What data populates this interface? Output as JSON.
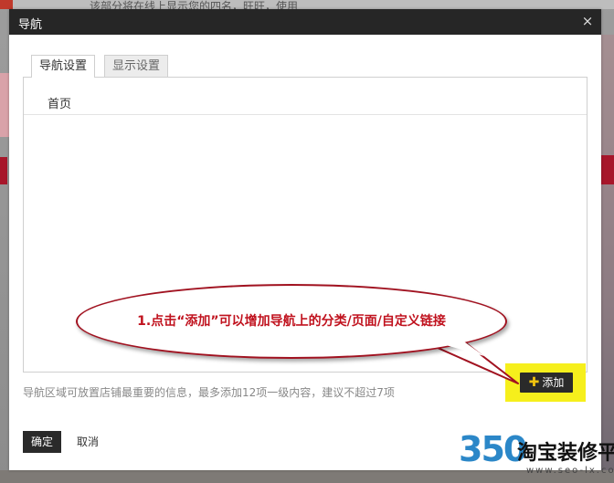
{
  "background": {
    "top_text": "该部分将在线上显示您的四名，旺旺，使用"
  },
  "dialog": {
    "title": "导航",
    "close_symbol": "×"
  },
  "tabs": [
    {
      "label": "导航设置",
      "active": true
    },
    {
      "label": "显示设置",
      "active": false
    }
  ],
  "nav_list": {
    "items": [
      {
        "label": "首页"
      }
    ]
  },
  "hint": "导航区域可放置店铺最重要的信息，最多添加12项一级内容，建议不超过7项",
  "add_button": {
    "icon": "plus-icon",
    "label": "添加"
  },
  "footer": {
    "ok_label": "确定",
    "cancel_label": "取消"
  },
  "callout": {
    "text": "1.点击“添加”可以增加导航上的分类/页面/自定义链接"
  },
  "watermark": {
    "number": "350",
    "text": "淘宝装修平台",
    "url": "www.seo-lx.com"
  },
  "colors": {
    "header_bg": "#262626",
    "button_bg": "#2a2a2a",
    "highlight": "#f6ef1c",
    "callout_border": "#a11220",
    "callout_text": "#c0121e",
    "watermark_blue": "#2b87c8"
  }
}
